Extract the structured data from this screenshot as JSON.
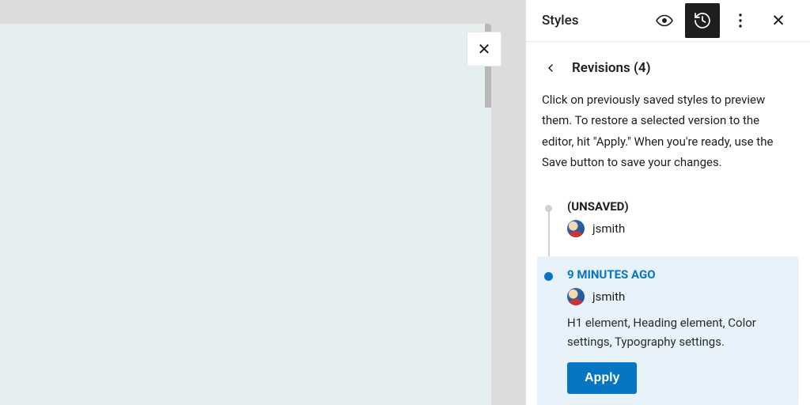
{
  "panel": {
    "title": "Styles"
  },
  "sub": {
    "title": "Revisions (4)",
    "description": "Click on previously saved styles to preview them. To restore a selected version to the editor, hit \"Apply.\" When you're ready, use the Save button to save your changes."
  },
  "revisions": [
    {
      "time": "(UNSAVED)",
      "user": "jsmith"
    },
    {
      "time": "9 MINUTES AGO",
      "user": "jsmith",
      "desc": "H1 element, Heading element, Color settings, Typography settings.",
      "apply": "Apply"
    }
  ]
}
